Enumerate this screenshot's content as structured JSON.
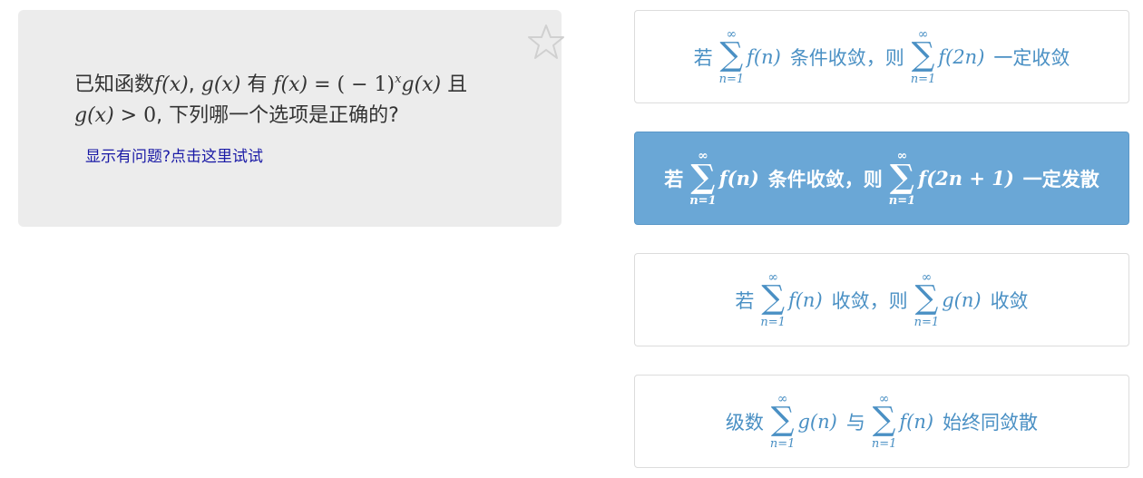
{
  "question": {
    "text_part1": "已知函数",
    "f_x": "f(x)",
    "comma1": ",",
    "g_x": "g(x)",
    "has": "有",
    "f_x2": "f(x)",
    "eq": " = ( − 1)",
    "exp": "x",
    "g_x2": "g(x)",
    "and": "且",
    "g_x3": "g(x)",
    "gt0": " > 0",
    "text_part2": ", 下列哪一个选项是正确的?"
  },
  "help_link": "显示有问题?点击这里试试",
  "star_icon": "star-outline-icon",
  "sum_symbol": "∑",
  "sum_upper": "∞",
  "sum_lower": "n=1",
  "options": [
    {
      "pre": "若",
      "expr1": "f(n)",
      "mid": "条件收敛，则",
      "expr2": "f(2n)",
      "post": "一定收敛",
      "selected": false
    },
    {
      "pre": "若",
      "expr1": "f(n)",
      "mid": "条件收敛，则",
      "expr2": "f(2n + 1)",
      "post": "一定发散",
      "selected": true
    },
    {
      "pre": "若",
      "expr1": "f(n)",
      "mid": "收敛，则",
      "expr2": "g(n)",
      "post": "收敛",
      "selected": false
    },
    {
      "pre": "级数",
      "expr1": "g(n)",
      "mid": "与",
      "expr2": "f(n)",
      "post": "始终同敛散",
      "selected": false
    }
  ],
  "colors": {
    "card_bg": "#ececec",
    "option_text": "#4a90c4",
    "selected_bg": "#6aa7d6",
    "link": "#1a1aa6"
  }
}
